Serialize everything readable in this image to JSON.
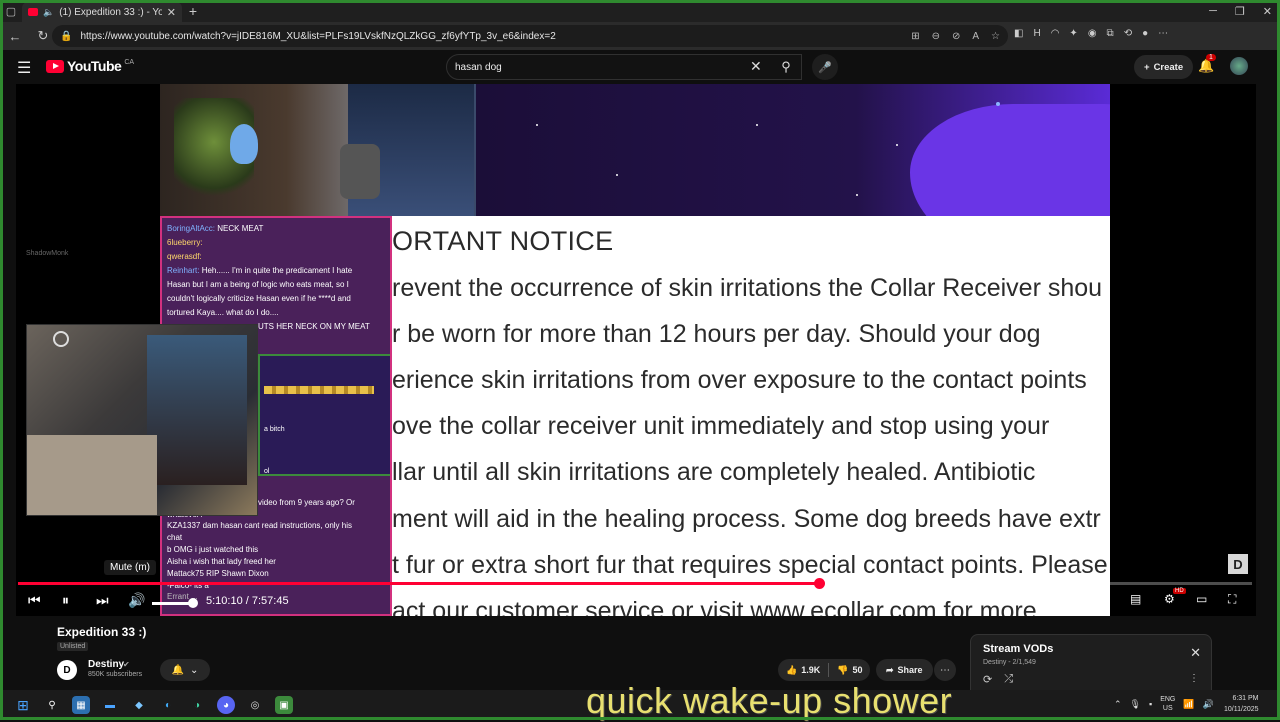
{
  "browser": {
    "tab_title": "(1) Expedition 33 :) - YouTube",
    "url": "https://www.youtube.com/watch?v=jIDE816M_XU&list=PLFs19LVskfNzQLZkGG_zf6yfYTp_3v_e6&index=2"
  },
  "youtube": {
    "logo_text": "YouTube",
    "region": "CA",
    "search_value": "hasan dog",
    "create_label": "Create",
    "notification_count": "1"
  },
  "video": {
    "notice_title": "ORTANT NOTICE",
    "notice_lines": [
      "revent the occurrence of skin irritations the Collar Receiver shou",
      "r be worn for more than 12 hours per day. Should your dog",
      "erience skin irritations from over exposure to the contact points",
      "ove the collar receiver unit immediately and stop using your",
      "llar until all skin irritations are completely healed. Antibiotic",
      "ment will aid in the healing process. Some dog breeds have extr",
      "t fur or extra short fur that requires special contact points. Please",
      "act our customer service or visit www.ecollar.com for more"
    ],
    "chat_top": [
      {
        "user": "BoringAltAcc:",
        "text": " NECK MEAT"
      },
      {
        "user": "6lueberry:",
        "text": ""
      },
      {
        "user": "qwerasdf:",
        "text": ""
      },
      {
        "user": "Reinhart:",
        "text": " Heh...... I'm in quite the predicament  I hate"
      },
      {
        "user": "",
        "text": "Hasan but I am a being of logic who eats meat, so I"
      },
      {
        "user": "",
        "text": "couldn't logically criticize Hasan even if he ****d and"
      },
      {
        "user": "",
        "text": "tortured Kaya.... what do I do...."
      },
      {
        "user": "",
        "text": "UTS HER NECK ON MY MEAT"
      }
    ],
    "chat_emote_text": "a bitch",
    "chat_emote_text2": "ol",
    "chat_bottom": [
      "video from 9 years ago? Or",
      "whatever?",
      "KZA1337 dam hasan cant read instructions, only his",
      "chat",
      "b OMG i just watched this",
      "Aisha i wish that lady freed her",
      "Mattack75 RIP Shawn Dixon",
      "-Falco- its a",
      "Errant ..."
    ],
    "shadowmonk": "ShadowMonk",
    "tooltip": "Mute (m)",
    "time_display": "5:10:10 / 7:57:45",
    "progress_fraction": 0.649,
    "volume_fraction": 0.9,
    "hd_badge": "HD"
  },
  "meta": {
    "title": "Expedition 33 :)",
    "visibility": "Unlisted",
    "channel": "Destiny",
    "subscribers": "850K subscribers",
    "likes": "1.9K",
    "dislikes": "50",
    "share_label": "Share"
  },
  "playlist": {
    "title": "Stream VODs",
    "subtitle": "Destiny - 2/1,549"
  },
  "caption": "quick wake-up shower",
  "taskbar": {
    "lang_top": "ENG",
    "lang_bottom": "US",
    "time": "6:31 PM",
    "date": "10/11/2025"
  }
}
